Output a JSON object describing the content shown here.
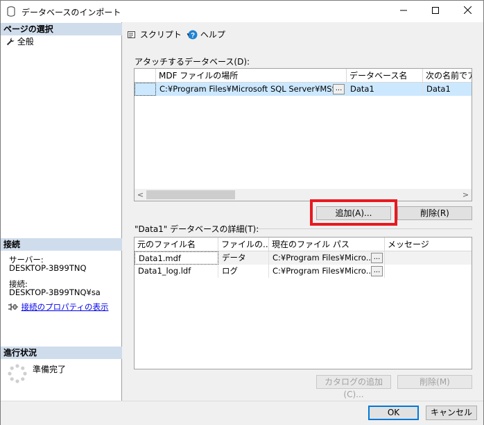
{
  "window": {
    "title": "データベースのインポート",
    "controls": {
      "minimize": "—",
      "maximize": "☐",
      "close": "✕"
    }
  },
  "left": {
    "page_select_header": "ページの選択",
    "pages": [
      {
        "label": "全般",
        "icon": "wrench-icon"
      }
    ],
    "connection_header": "接続",
    "server_label": "サーバー:",
    "server_value": "DESKTOP-3B99TNQ",
    "connection_label": "接続:",
    "connection_value": "DESKTOP-3B99TNQ¥sa",
    "view_connection_props": "接続のプロパティの表示",
    "progress_header": "進行状況",
    "progress_status": "準備完了"
  },
  "toolbar": {
    "script_label": "スクリプト",
    "help_label": "ヘルプ"
  },
  "attach_section": {
    "label": "アタッチするデータベース(D):",
    "columns": [
      "",
      "MDF ファイルの場所",
      "データベース名",
      "次の名前でア"
    ],
    "rows": [
      {
        "mdf": "C:¥Program Files¥Microsoft SQL Server¥MSS...",
        "dbname": "Data1",
        "attach_as": "Data1"
      }
    ],
    "ellipsis": "...",
    "add_button": "追加(A)...",
    "remove_button": "削除(R)"
  },
  "details_section": {
    "label": "\"Data1\" データベースの詳細(T):",
    "columns": [
      "元のファイル名",
      "ファイルの...",
      "現在のファイル パス",
      "メッセージ"
    ],
    "rows": [
      {
        "original": "Data1.mdf",
        "type": "データ",
        "path": "C:¥Program Files¥Micro...",
        "message": ""
      },
      {
        "original": "Data1_log.ldf",
        "type": "ログ",
        "path": "C:¥Program Files¥Micro...",
        "message": ""
      }
    ],
    "ellipsis": "...",
    "add_catalog_button": "カタログの追加(C)...",
    "remove_button": "削除(M)"
  },
  "footer": {
    "ok_button": "OK",
    "cancel_button": "キャンセル"
  },
  "colors": {
    "selected_row": "#cce8ff",
    "section_header": "#cfdcec",
    "highlight": "#e8191f",
    "link": "#0000ee"
  }
}
